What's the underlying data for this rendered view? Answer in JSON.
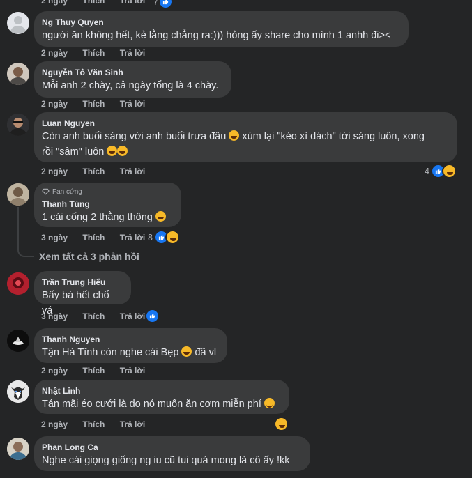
{
  "top": {
    "time": "2 ngày",
    "like": "Thích",
    "reply": "Trả lời",
    "count": "7"
  },
  "comments": [
    {
      "name": "Ng Thuy Quyen",
      "text": "người ăn không hết, kẻ lằng chẳng ra:))) hỏng ấy share cho mình 1 anhh đi><",
      "time": "2 ngày",
      "like": "Thích",
      "reply": "Trả lời"
    },
    {
      "name": "Nguyễn Tô Văn Sinh",
      "text": "Mỗi anh 2 chày, cả ngày tổng là 4 chày.",
      "time": "2 ngày",
      "like": "Thích",
      "reply": "Trả lời"
    },
    {
      "name": "Luan Nguyen",
      "text1": "Còn anh buổi sáng với anh buổi trưa đâu",
      "text1b": "xúm lại \"kéo xì dách\" tới sáng luôn, xong",
      "text2": "rồi \"sâm\" luôn",
      "time": "2 ngày",
      "like": "Thích",
      "reply": "Trả lời",
      "reactions": "4"
    },
    {
      "badge": "Fan cứng",
      "name": "Thanh Tùng",
      "text": "1 cái cống 2 thằng thông",
      "time": "3 ngày",
      "like": "Thích",
      "reply": "Trả lời",
      "reactions": "8",
      "view_replies": "Xem tất cả 3 phản hồi"
    },
    {
      "name": "Trần Trung Hiếu",
      "text": "Bấy bá hết chổ vá",
      "time": "3 ngày",
      "like": "Thích",
      "reply": "Trả lời"
    },
    {
      "name": "Thanh Nguyen",
      "text": "Tận Hà Tĩnh còn nghe cái Bẹp",
      "text_b": "đã vl",
      "time": "2 ngày",
      "like": "Thích",
      "reply": "Trả lời"
    },
    {
      "name": "Nhật Linh",
      "text": "Tán mãi éo cưới là do nó muốn ăn cơm miễn phí",
      "time": "2 ngày",
      "like": "Thích",
      "reply": "Trả lời"
    },
    {
      "name": "Phan Long Ca",
      "text": "Nghe cái giọng giống ng iu cũ tui quá mong là cô ấy !kk"
    }
  ],
  "colors": {
    "background": "#242526",
    "bubble": "#3a3b3c",
    "like": "#1877f2",
    "haha": "#f7b928"
  }
}
